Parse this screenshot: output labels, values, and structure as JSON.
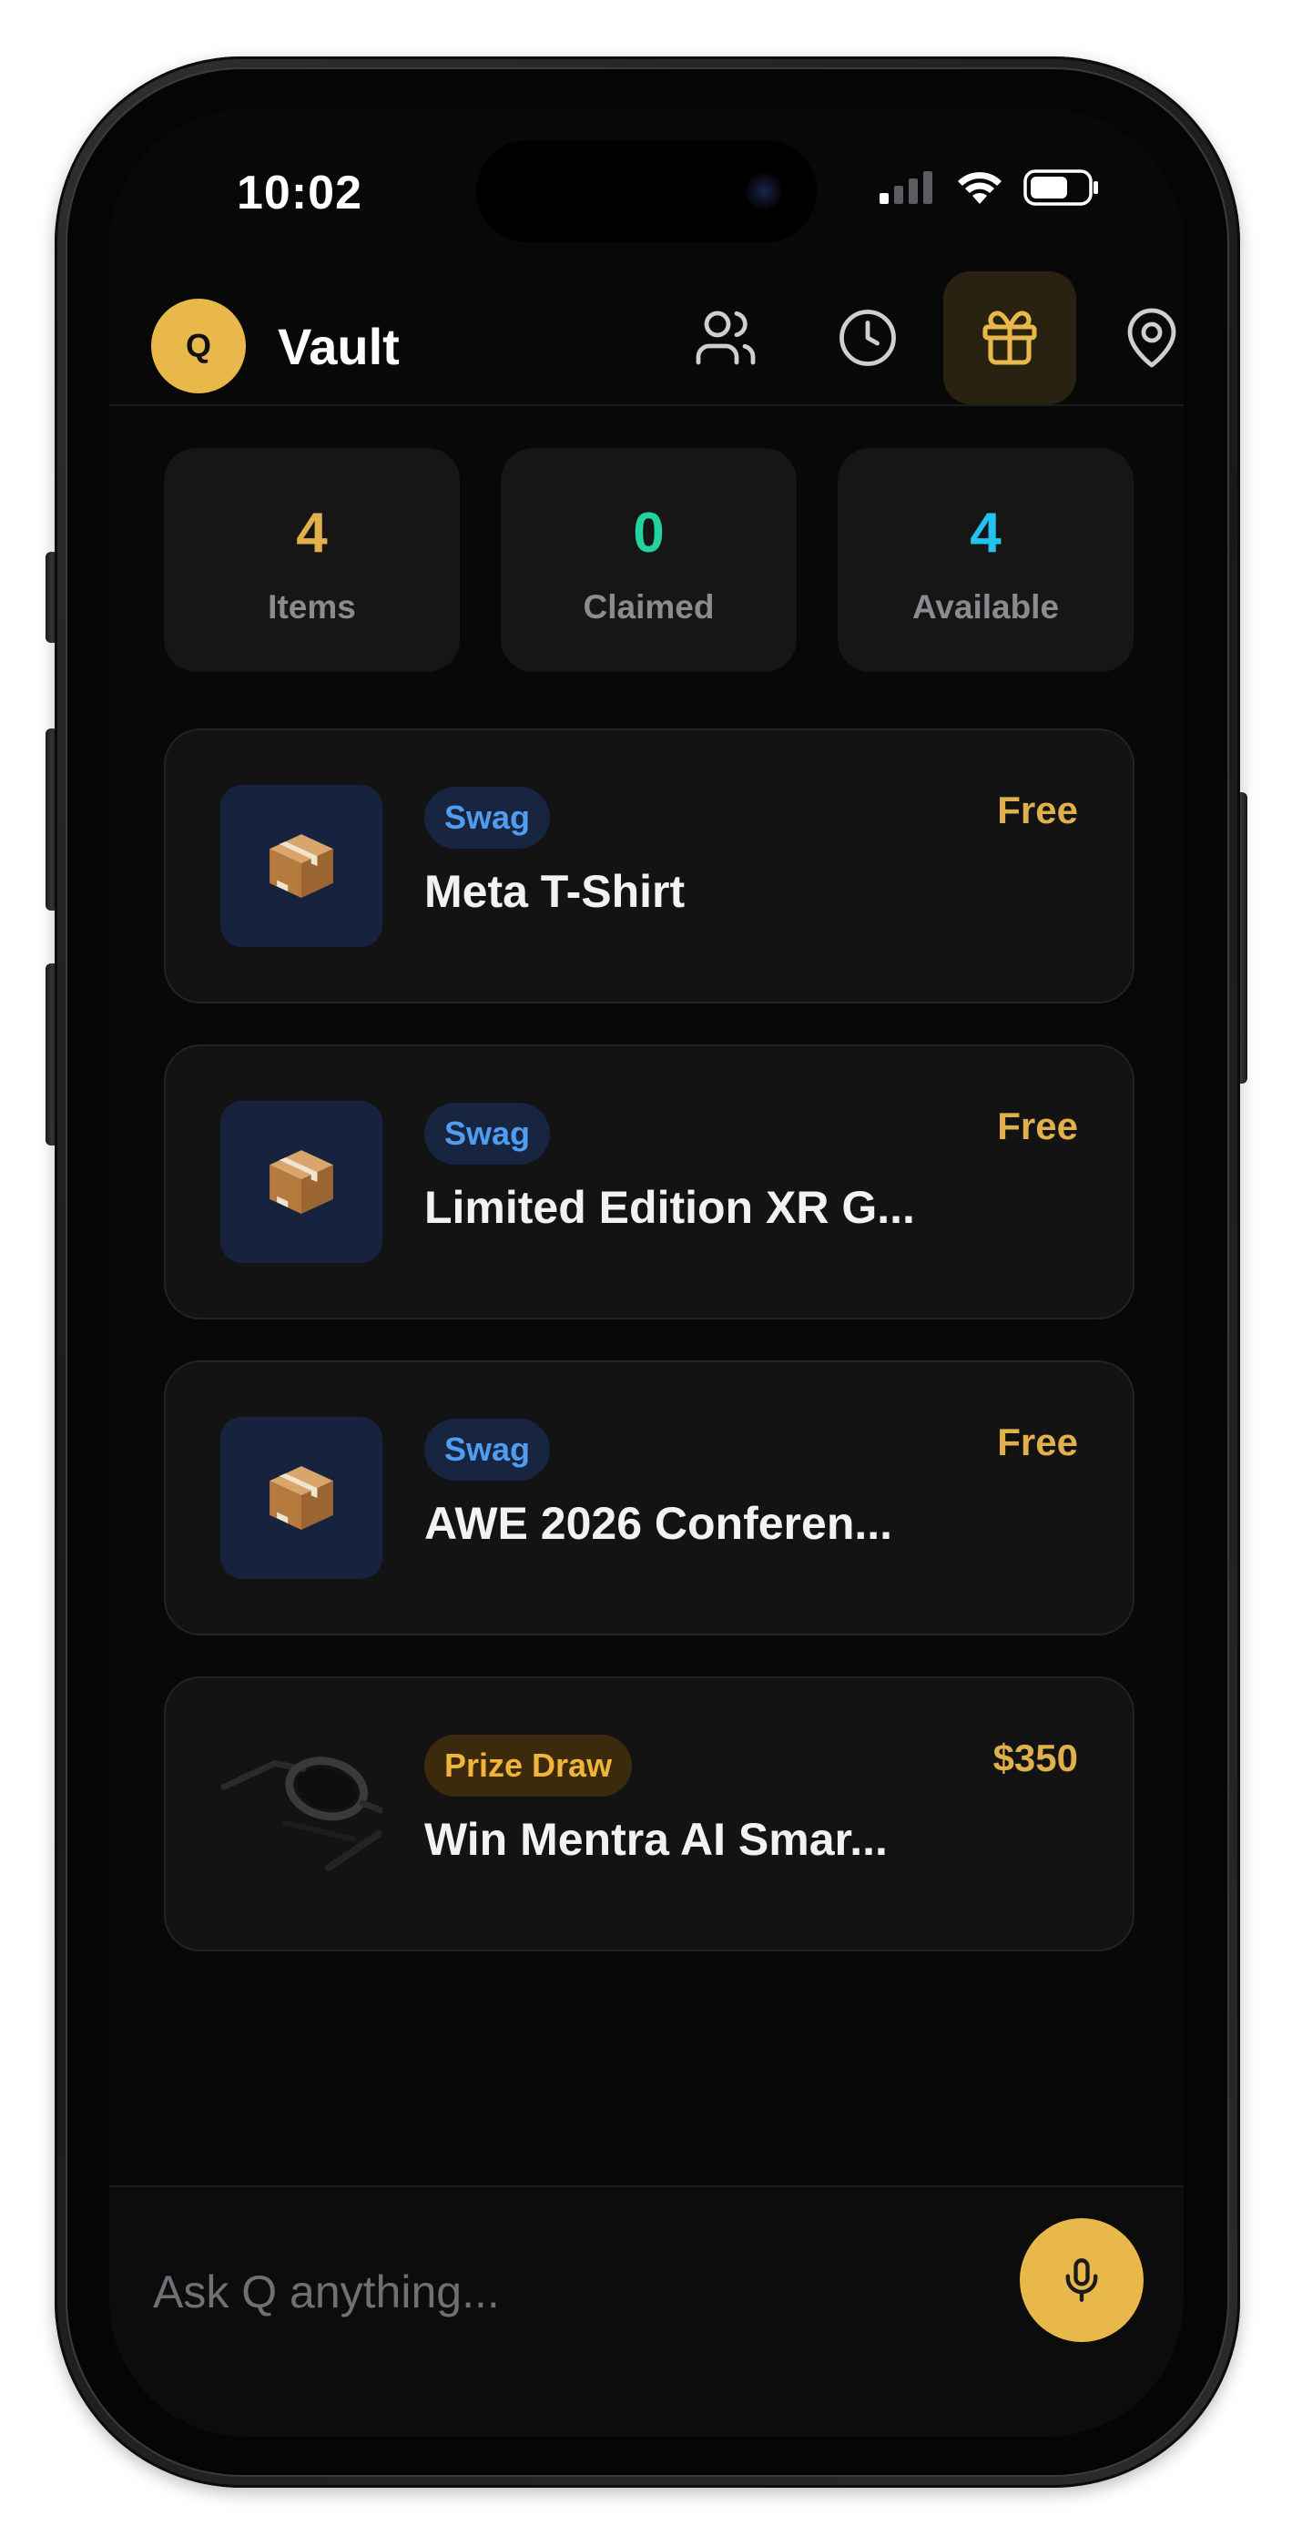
{
  "status_bar": {
    "time": "10:02"
  },
  "header": {
    "avatar_letter": "Q",
    "title": "Vault",
    "nav": [
      {
        "icon": "people-icon",
        "active": false
      },
      {
        "icon": "clock-icon",
        "active": false
      },
      {
        "icon": "gift-icon",
        "active": true
      },
      {
        "icon": "location-pin-icon",
        "active": false
      }
    ]
  },
  "stats": [
    {
      "value": "4",
      "label": "Items",
      "color": "#e0b04c"
    },
    {
      "value": "0",
      "label": "Claimed",
      "color": "#22d3a0"
    },
    {
      "value": "4",
      "label": "Available",
      "color": "#22c3f0"
    }
  ],
  "items": [
    {
      "tag": "Swag",
      "title": "Meta T-Shirt",
      "price": "Free",
      "icon": "package-icon"
    },
    {
      "tag": "Swag",
      "title": "Limited Edition XR G...",
      "price": "Free",
      "icon": "package-icon"
    },
    {
      "tag": "Swag",
      "title": "AWE 2026 Conferen...",
      "price": "Free",
      "icon": "package-icon"
    },
    {
      "tag": "Prize Draw",
      "title": "Win Mentra AI Smar...",
      "price": "$350",
      "icon": "smart-glasses-image"
    }
  ],
  "ask": {
    "placeholder": "Ask Q anything..."
  },
  "colors": {
    "accent": "#e8b84a",
    "swag_tag": "#4f9cf0",
    "prize_tag": "#f0b43a",
    "price": "#e0b04c"
  }
}
